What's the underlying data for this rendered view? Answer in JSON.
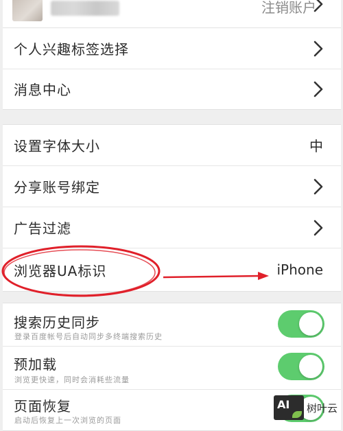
{
  "account": {
    "logout_label": "注销账户"
  },
  "group1": {
    "items": [
      {
        "label": "个人兴趣标签选择"
      },
      {
        "label": "消息中心"
      }
    ]
  },
  "group2": {
    "items": [
      {
        "label": "设置字体大小",
        "value": "中"
      },
      {
        "label": "分享账号绑定"
      },
      {
        "label": "广告过滤"
      },
      {
        "label": "浏览器UA标识",
        "value": "iPhone"
      }
    ]
  },
  "group3": {
    "items": [
      {
        "label": "搜索历史同步",
        "sub": "登录百度帐号后自动同步多终端搜索历史",
        "on": true
      },
      {
        "label": "预加载",
        "sub": "浏览更快速，同时会消耗些流量",
        "on": true
      },
      {
        "label": "页面恢复",
        "sub": "启动后恢复上一次浏览的页面",
        "on": true
      }
    ]
  },
  "annotation": {
    "color": "#e0202a"
  },
  "watermark": {
    "logo_text": "AI",
    "name": "树叶云"
  },
  "colors": {
    "toggle_on": "#5dcc6e",
    "background": "#efefef"
  }
}
